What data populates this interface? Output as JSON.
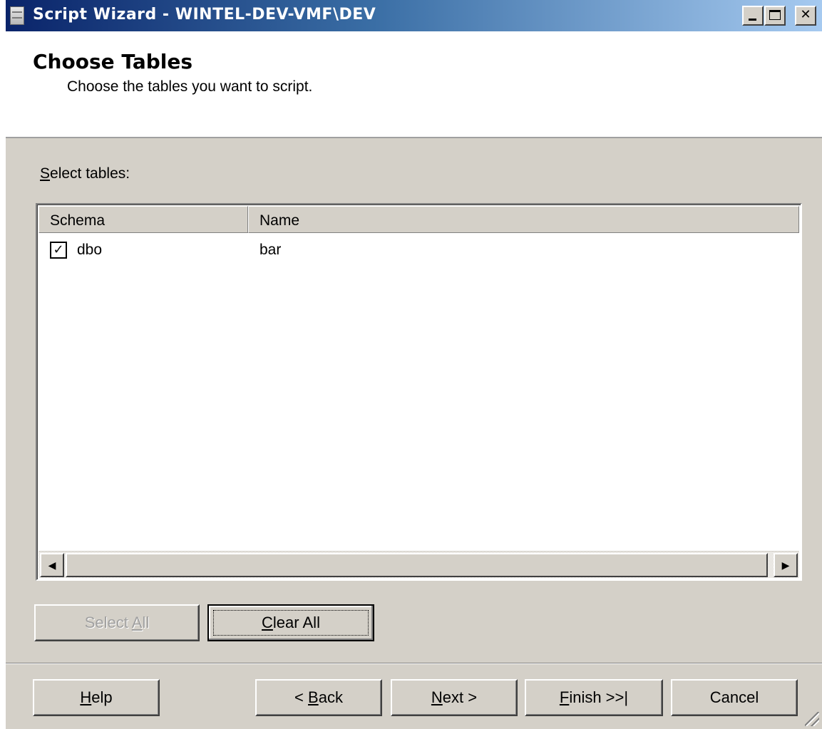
{
  "window": {
    "title": "Script Wizard - WINTEL-DEV-VMF\\DEV"
  },
  "header": {
    "title": "Choose Tables",
    "subtitle": "Choose the tables you want to script."
  },
  "select_tables": {
    "label_mnemonic": "S",
    "label_rest": "elect tables:"
  },
  "table": {
    "columns": [
      "Schema",
      "Name"
    ],
    "rows": [
      {
        "checked": true,
        "check_glyph": "✓",
        "schema": "dbo",
        "name": "bar"
      }
    ]
  },
  "scrollbar": {
    "left_arrow": "◀",
    "right_arrow": "▶"
  },
  "selection_buttons": {
    "select_all": {
      "pre": "Select ",
      "mnemonic": "A",
      "post": "ll",
      "enabled": false
    },
    "clear_all": {
      "pre": "",
      "mnemonic": "C",
      "post": "lear All",
      "enabled": true,
      "focused": true
    }
  },
  "footer_buttons": {
    "help": {
      "pre": "",
      "mnemonic": "H",
      "post": "elp"
    },
    "back": {
      "pre": "< ",
      "mnemonic": "B",
      "post": "ack"
    },
    "next": {
      "pre": "",
      "mnemonic": "N",
      "post": "ext >"
    },
    "finish": {
      "pre": "",
      "mnemonic": "F",
      "post": "inish >>|"
    },
    "cancel": {
      "pre": "Cancel",
      "mnemonic": "",
      "post": ""
    }
  },
  "colors": {
    "titlebar_start": "#0a246a",
    "titlebar_end": "#a6caf0",
    "face": "#d4d0c8"
  }
}
